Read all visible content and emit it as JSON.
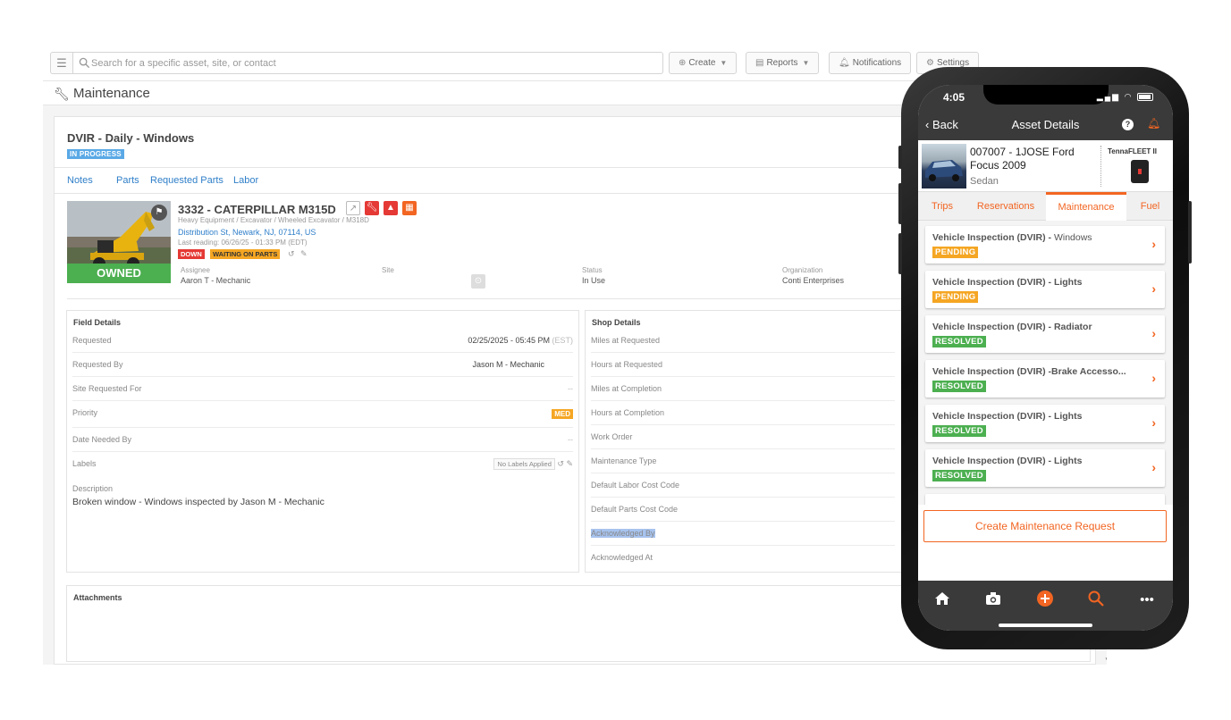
{
  "desktop": {
    "search": {
      "placeholder": "Search for a specific asset, site, or contact"
    },
    "toolbar": {
      "create_label": "Create",
      "reports_label": "Reports",
      "notifications_label": "Notifications",
      "settings_label": "Settings"
    },
    "page_title": "Maintenance",
    "work_order": {
      "title": "DVIR - Daily - Windows",
      "status": "IN PROGRESS",
      "tabs": [
        "Notes",
        "Parts",
        "Requested Parts",
        "Labor"
      ]
    },
    "asset": {
      "name": "3332 - CATERPILLAR M315D",
      "type": "Heavy Equipment / Excavator / Wheeled Excavator / M318D",
      "address": "Distribution St, Newark, NJ, 07114, US",
      "last_reading": "Last reading: 06/26/25 - 01:33 PM (EDT)",
      "badges": [
        "DOWN",
        "WAITING ON PARTS"
      ],
      "ownership": "OWNED",
      "meta": [
        {
          "label": "Assignee",
          "value": "Aaron T  - Mechanic"
        },
        {
          "label": "Site",
          "value": ""
        },
        {
          "label": "Status",
          "value": "In Use"
        },
        {
          "label": "Organization",
          "value": "Conti Enterprises"
        }
      ]
    },
    "field_details": {
      "title": "Field Details",
      "rows": [
        {
          "label": "Requested",
          "value": "02/25/2025 - 05:45 PM",
          "suffix": "(EST)"
        },
        {
          "label": "Requested By",
          "value": "Jason M - Mechanic"
        },
        {
          "label": "Site Requested For",
          "value": "--"
        },
        {
          "label": "Priority",
          "value": "MED"
        },
        {
          "label": "Date Needed By",
          "value": "--"
        },
        {
          "label": "Labels",
          "value": "No Labels Applied"
        }
      ],
      "description_label": "Description",
      "description_value": "Broken window - Windows inspected by Jason M  - Mechanic"
    },
    "shop_details": {
      "title": "Shop Details",
      "rows": [
        "Miles at Requested",
        "Hours at Requested",
        "Miles at Completion",
        "Hours at Completion",
        "Work Order",
        "Maintenance Type",
        "Default Labor Cost Code",
        "Default Parts Cost Code",
        "Acknowledged By",
        "Acknowledged At"
      ]
    },
    "attachments": {
      "title": "Attachments"
    }
  },
  "phone": {
    "time": "4:05",
    "nav": {
      "back_label": "Back",
      "title": "Asset Details"
    },
    "asset": {
      "name": "007007 - 1JOSE Ford Focus 2009",
      "type": "Sedan",
      "device": "TennaFLEET II"
    },
    "tabs": [
      "Trips",
      "Reservations",
      "Maintenance",
      "Fuel"
    ],
    "active_tab": "Maintenance",
    "items": [
      {
        "title": "Vehicle Inspection (DVIR) - ",
        "title_rest": " Windows",
        "status": "PENDING"
      },
      {
        "title": "Vehicle Inspection (DVIR) - Lights",
        "title_rest": "",
        "status": "PENDING"
      },
      {
        "title": "Vehicle Inspection (DVIR) - Radiator",
        "title_rest": "",
        "status": "RESOLVED"
      },
      {
        "title": "Vehicle Inspection (DVIR) -Brake Accesso...",
        "title_rest": "",
        "status": "RESOLVED"
      },
      {
        "title": "Vehicle Inspection (DVIR) - Lights",
        "title_rest": "",
        "status": "RESOLVED"
      },
      {
        "title": "Vehicle Inspection (DVIR) - Lights",
        "title_rest": "",
        "status": "RESOLVED"
      }
    ],
    "create_label": "Create Maintenance Request"
  },
  "colors": {
    "brand_orange": "#f26522",
    "pending": "#f5a623",
    "resolved": "#4caf50",
    "link_blue": "#2f7fc9",
    "in_progress": "#5aa9e6",
    "down_red": "#e53935"
  }
}
